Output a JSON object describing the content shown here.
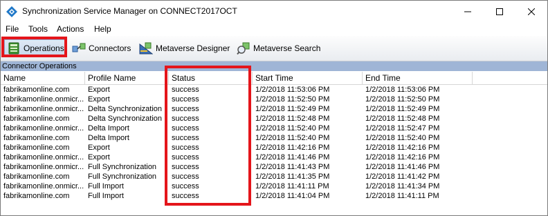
{
  "window": {
    "title": "Synchronization Service Manager on CONNECT2017OCT",
    "controls": [
      "minimize-icon",
      "maximize-icon",
      "close-icon"
    ]
  },
  "menu": [
    "File",
    "Tools",
    "Actions",
    "Help"
  ],
  "toolbar": {
    "buttons": [
      {
        "label": "Operations",
        "icon": "operations-icon",
        "active": true
      },
      {
        "label": "Connectors",
        "icon": "connectors-icon"
      },
      {
        "label": "Metaverse Designer",
        "icon": "metaverse-designer-icon"
      },
      {
        "label": "Metaverse Search",
        "icon": "metaverse-search-icon"
      }
    ]
  },
  "section": {
    "title": "Connector Operations"
  },
  "table": {
    "columns": [
      "Name",
      "Profile Name",
      "Status",
      "Start Time",
      "End Time"
    ],
    "rows": [
      [
        "fabrikamonline.com",
        "Export",
        "success",
        "1/2/2018 11:53:06 PM",
        "1/2/2018 11:53:06 PM"
      ],
      [
        "fabrikamonline.onmicr...",
        "Export",
        "success",
        "1/2/2018 11:52:50 PM",
        "1/2/2018 11:52:50 PM"
      ],
      [
        "fabrikamonline.onmicr...",
        "Delta Synchronization",
        "success",
        "1/2/2018 11:52:49 PM",
        "1/2/2018 11:52:49 PM"
      ],
      [
        "fabrikamonline.com",
        "Delta Synchronization",
        "success",
        "1/2/2018 11:52:48 PM",
        "1/2/2018 11:52:48 PM"
      ],
      [
        "fabrikamonline.onmicr...",
        "Delta Import",
        "success",
        "1/2/2018 11:52:40 PM",
        "1/2/2018 11:52:47 PM"
      ],
      [
        "fabrikamonline.com",
        "Delta Import",
        "success",
        "1/2/2018 11:52:40 PM",
        "1/2/2018 11:52:40 PM"
      ],
      [
        "fabrikamonline.com",
        "Export",
        "success",
        "1/2/2018 11:42:16 PM",
        "1/2/2018 11:42:16 PM"
      ],
      [
        "fabrikamonline.onmicr...",
        "Export",
        "success",
        "1/2/2018 11:41:46 PM",
        "1/2/2018 11:42:16 PM"
      ],
      [
        "fabrikamonline.onmicr...",
        "Full Synchronization",
        "success",
        "1/2/2018 11:41:43 PM",
        "1/2/2018 11:41:46 PM"
      ],
      [
        "fabrikamonline.com",
        "Full Synchronization",
        "success",
        "1/2/2018 11:41:35 PM",
        "1/2/2018 11:41:42 PM"
      ],
      [
        "fabrikamonline.onmicr...",
        "Full Import",
        "success",
        "1/2/2018 11:41:11 PM",
        "1/2/2018 11:41:34 PM"
      ],
      [
        "fabrikamonline.com",
        "Full Import",
        "success",
        "1/2/2018 11:41:04 PM",
        "1/2/2018 11:41:11 PM"
      ]
    ]
  },
  "colors": {
    "highlight": "#e4151b",
    "section_header": "#9fb5d6"
  }
}
